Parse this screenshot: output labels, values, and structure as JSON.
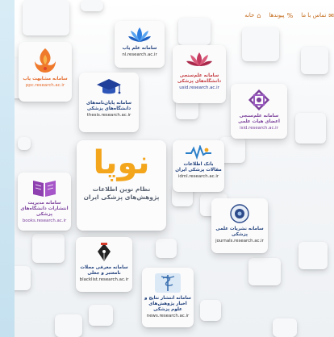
{
  "nav": {
    "items": [
      {
        "label": "خانه",
        "icon": "home-icon"
      },
      {
        "label": "پیوندها",
        "icon": "link-icon"
      },
      {
        "label": "تماس با ما",
        "icon": "envelope-icon"
      }
    ]
  },
  "center": {
    "logo_text": "نوپا",
    "line1": "نظام نوین اطلاعات",
    "line2": "پژوهش‌های پزشکی ایران"
  },
  "tiles": [
    {
      "title": "سامانه علم یاب",
      "url": "nl.research.ac.ir"
    },
    {
      "title": "سامانه مشابهت یاب",
      "url": "ppc.research.ac.ir"
    },
    {
      "title": "سامانه علم‌سنجی دانشگاه‌های پزشکی",
      "url": "usid.research.ac.ir"
    },
    {
      "title": "سامانه پایان‌نامه‌های دانشگاه‌های پزشکی",
      "url": "thesis.research.ac.ir"
    },
    {
      "title": "سامانه علم‌سنجی اعضای هیات علمی",
      "url": "isid.research.ac.ir"
    },
    {
      "title": "بانک اطلاعات مقالات پزشکی ایران",
      "url": "idml.research.ac.ir"
    },
    {
      "title": "سامانه مدیریت انتشارات دانشگاه‌های پزشکی",
      "url": "books.research.ac.ir"
    },
    {
      "title": "سامانه نشریات علمی پزشکی",
      "url": "journals.research.ac.ir"
    },
    {
      "title": "سامانه معرفی مجلات نامعتبر و جعلی",
      "url": "blacklist.research.ac.ir"
    },
    {
      "title": "سامانه انتشار نتایج و اخبار پژوهش‌های علوم پزشکی",
      "url": "news.research.ac.ir"
    }
  ],
  "colors": {
    "accent": "#f3a51b",
    "nav_text": "#c46a1a",
    "background": "#cfe6f2"
  }
}
